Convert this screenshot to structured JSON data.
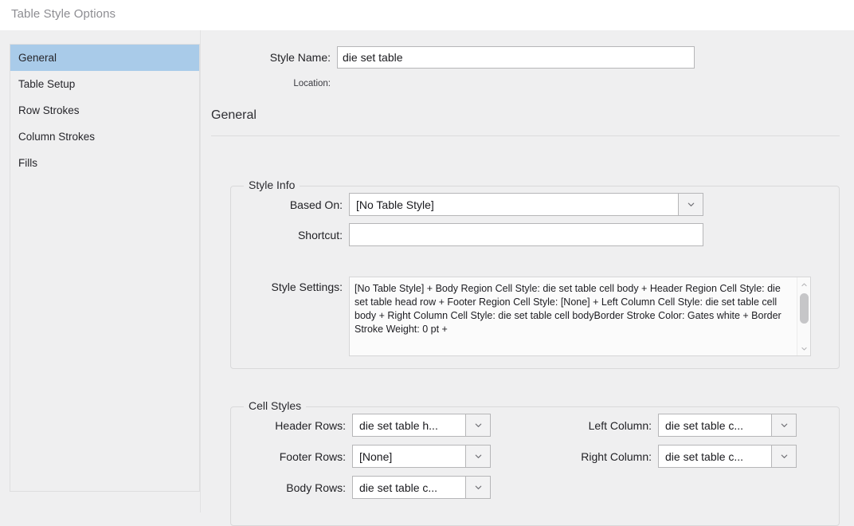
{
  "window": {
    "title": "Table Style Options"
  },
  "sidebar": {
    "items": [
      {
        "label": "General",
        "selected": true
      },
      {
        "label": "Table Setup",
        "selected": false
      },
      {
        "label": "Row Strokes",
        "selected": false
      },
      {
        "label": "Column Strokes",
        "selected": false
      },
      {
        "label": "Fills",
        "selected": false
      }
    ]
  },
  "header": {
    "style_name_label": "Style Name:",
    "style_name_value": "die set table",
    "location_label": "Location:",
    "location_value": ""
  },
  "section": {
    "title": "General"
  },
  "style_info": {
    "group_title": "Style Info",
    "based_on_label": "Based On:",
    "based_on_value": "[No Table Style]",
    "shortcut_label": "Shortcut:",
    "shortcut_value": "",
    "style_settings_label": "Style Settings:",
    "style_settings_value": "[No Table Style] + Body Region Cell Style: die set table cell body + Header Region Cell Style: die set table head row + Footer Region Cell Style: [None] + Left Column Cell Style: die set table cell body + Right Column Cell Style: die set table cell bodyBorder Stroke Color: Gates white + Border Stroke Weight: 0 pt +"
  },
  "cell_styles": {
    "group_title": "Cell Styles",
    "header_rows_label": "Header Rows:",
    "header_rows_value": "die set table h...",
    "footer_rows_label": "Footer Rows:",
    "footer_rows_value": "[None]",
    "body_rows_label": "Body Rows:",
    "body_rows_value": "die set table c...",
    "left_column_label": "Left Column:",
    "left_column_value": "die set table c...",
    "right_column_label": "Right Column:",
    "right_column_value": "die set table c..."
  },
  "colors": {
    "dialog_background": "#efeff0",
    "titlebar_background": "#ffffff",
    "selection_highlight": "#a9cbe9",
    "field_background": "#ffffff",
    "field_border": "#b6b6b8",
    "group_border": "#d9d9da",
    "text_primary": "#1a1a1e",
    "title_text": "#8d8d92"
  },
  "icons": {
    "dropdown": "chevron-down-icon",
    "scroll_up": "chevron-up-icon",
    "scroll_down": "chevron-down-icon"
  }
}
